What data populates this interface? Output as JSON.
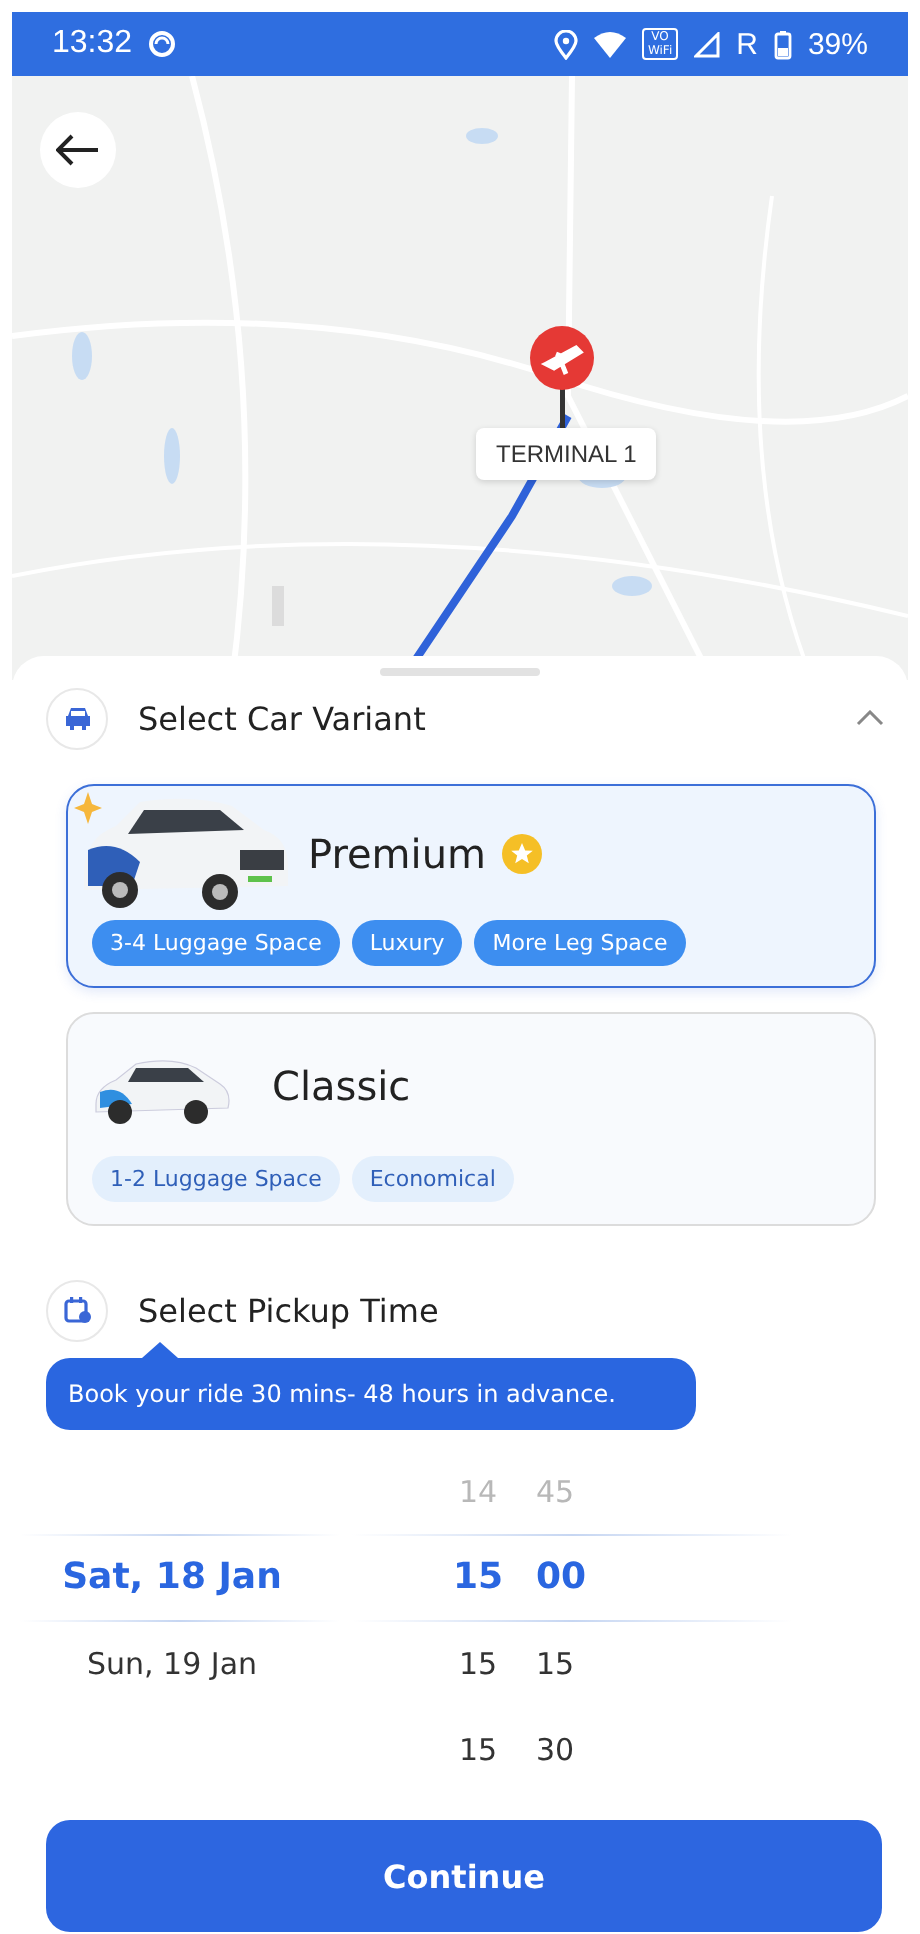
{
  "status_bar": {
    "time": "13:32",
    "vowifi": [
      "VO",
      "WiFi"
    ],
    "network": "R",
    "battery": "39%"
  },
  "map": {
    "marker_label": "TERMINAL 1"
  },
  "car_section": {
    "title": "Select Car Variant",
    "expanded": true,
    "variants": [
      {
        "name": "Premium",
        "selected": true,
        "premium": true,
        "tags": [
          "3-4 Luggage Space",
          "Luxury",
          "More Leg Space"
        ]
      },
      {
        "name": "Classic",
        "selected": false,
        "premium": false,
        "tags": [
          "1-2 Luggage Space",
          "Economical"
        ]
      }
    ]
  },
  "pickup_section": {
    "title": "Select Pickup Time",
    "tooltip": "Book your ride 30 mins- 48 hours in advance.",
    "columns": [
      {
        "kind": "date",
        "items": [
          {
            "label": "Sat, 18 Jan",
            "selected": true
          },
          {
            "label": "Sun, 19 Jan",
            "selected": false
          }
        ]
      },
      {
        "kind": "hour",
        "items": [
          {
            "label": "14",
            "selected": false
          },
          {
            "label": "15",
            "selected": true
          },
          {
            "label": "15",
            "selected": false
          },
          {
            "label": "15",
            "selected": false
          }
        ]
      },
      {
        "kind": "minute",
        "items": [
          {
            "label": "45",
            "selected": false
          },
          {
            "label": "00",
            "selected": true
          },
          {
            "label": "15",
            "selected": false
          },
          {
            "label": "30",
            "selected": false
          }
        ]
      }
    ]
  },
  "continue_button": "Continue"
}
